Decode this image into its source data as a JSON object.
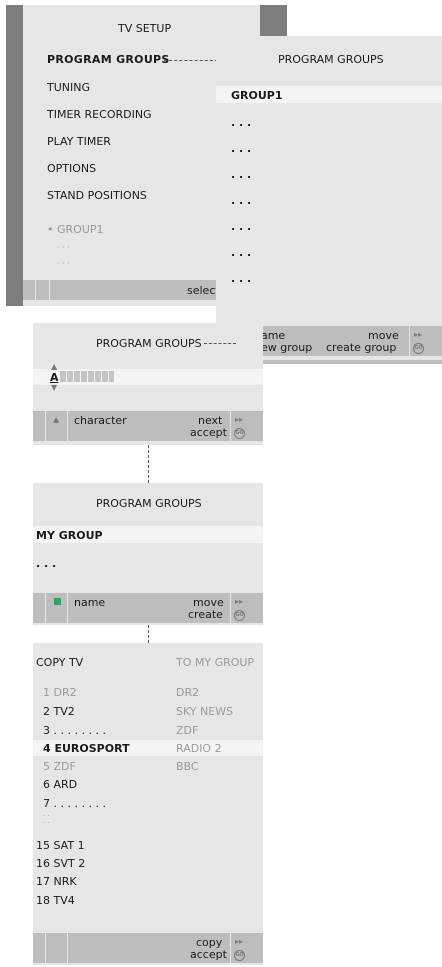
{
  "setup": {
    "title": "TV SETUP",
    "items": [
      "PROGRAM GROUPS",
      "TUNING",
      "TIMER RECORDING",
      "PLAY TIMER",
      "OPTIONS",
      "STAND POSITIONS"
    ],
    "sub_group": "GROUP1",
    "sub_dots": "· · ·",
    "footer": "select"
  },
  "groups": {
    "title": "PROGRAM GROUPS",
    "first": "GROUP1",
    "dots": ". . .",
    "footer_name": "name",
    "footer_move": "move",
    "footer_new": "new group",
    "footer_create": "create group"
  },
  "naming": {
    "title": "PROGRAM GROUPS",
    "letter": "A",
    "footer_char": "character",
    "footer_next": "next",
    "footer_accept": "accept"
  },
  "mygroup": {
    "title": "PROGRAM GROUPS",
    "name": "MY GROUP",
    "dots": ". . .",
    "footer_name": "name",
    "footer_move": "move",
    "footer_create": "create"
  },
  "copy": {
    "left_title": "COPY TV",
    "right_title": "TO MY GROUP",
    "left": [
      "1 DR2",
      "2 TV2",
      "3 . . . . . . . .",
      "4 EUROSPORT",
      "5 ZDF",
      "6 ARD",
      "7 . . . . . . . .",
      "15 SAT 1",
      "16 SVT 2",
      "17 NRK",
      "18 TV4"
    ],
    "right": [
      "DR2",
      "SKY NEWS",
      "ZDF",
      "RADIO 2",
      "BBC"
    ],
    "footer_copy": "copy",
    "footer_accept": "accept"
  },
  "icons": {
    "go": "GO",
    "arrow_right": "▸▸",
    "arrow_up": "▲",
    "arrow_down": "▼"
  },
  "colors": {
    "panel": "#e6e6e6",
    "bar": "#bdbdbd",
    "frame": "#7d7d7d",
    "green": "#2aa860"
  }
}
